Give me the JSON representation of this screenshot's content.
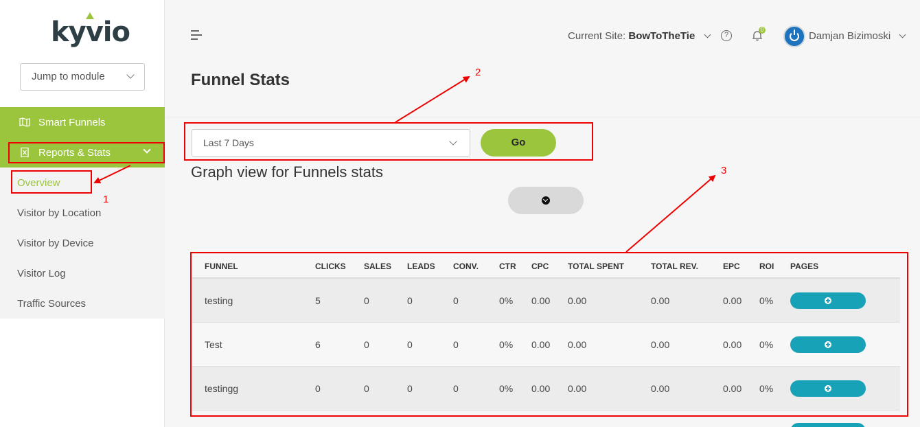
{
  "logo": {
    "text": "kyvio"
  },
  "sidebar": {
    "jump_placeholder": "Jump to module",
    "nav": [
      {
        "label": "Smart Funnels",
        "icon": "map-icon"
      },
      {
        "label": "Reports & Stats",
        "icon": "spreadsheet-icon"
      }
    ],
    "sub": [
      "Overview",
      "Visitor by Location",
      "Visitor by Device",
      "Visitor Log",
      "Traffic Sources"
    ],
    "active_sub": "Overview"
  },
  "header": {
    "current_site_label": "Current Site:",
    "current_site_value": "BowToTheTie",
    "notifications": "0",
    "username": "Damjan Bizimoski"
  },
  "page": {
    "title": "Funnel Stats",
    "range_value": "Last 7 Days",
    "go_label": "Go",
    "graph_title": "Graph view for Funnels stats"
  },
  "table": {
    "headers": [
      "FUNNEL",
      "CLICKS",
      "SALES",
      "LEADS",
      "CONV.",
      "CTR",
      "CPC",
      "TOTAL SPENT",
      "TOTAL REV.",
      "EPC",
      "ROI",
      "PAGES"
    ],
    "rows": [
      [
        "testing",
        "5",
        "0",
        "0",
        "0",
        "0%",
        "0.00",
        "0.00",
        "0.00",
        "0.00",
        "0%"
      ],
      [
        "Test",
        "6",
        "0",
        "0",
        "0",
        "0%",
        "0.00",
        "0.00",
        "0.00",
        "0.00",
        "0%"
      ],
      [
        "testingg",
        "0",
        "0",
        "0",
        "0",
        "0%",
        "0.00",
        "0.00",
        "0.00",
        "0.00",
        "0%"
      ]
    ]
  },
  "annotations": [
    "1",
    "2",
    "3"
  ],
  "colors": {
    "brand_green": "#9bc53d",
    "teal": "#17a2b8",
    "annotation_red": "#e00000"
  }
}
